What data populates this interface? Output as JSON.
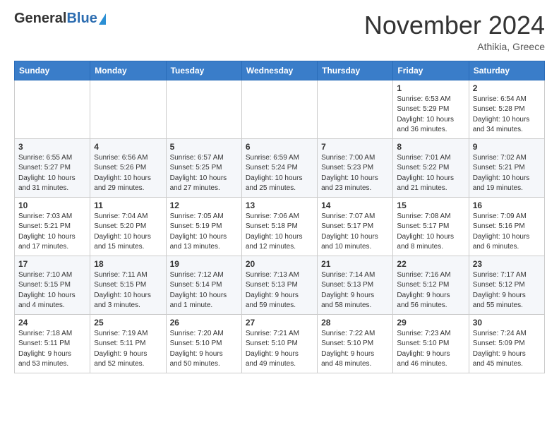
{
  "header": {
    "logo_general": "General",
    "logo_blue": "Blue",
    "month_title": "November 2024",
    "location": "Athikia, Greece"
  },
  "weekdays": [
    "Sunday",
    "Monday",
    "Tuesday",
    "Wednesday",
    "Thursday",
    "Friday",
    "Saturday"
  ],
  "weeks": [
    [
      {
        "day": "",
        "info": ""
      },
      {
        "day": "",
        "info": ""
      },
      {
        "day": "",
        "info": ""
      },
      {
        "day": "",
        "info": ""
      },
      {
        "day": "",
        "info": ""
      },
      {
        "day": "1",
        "info": "Sunrise: 6:53 AM\nSunset: 5:29 PM\nDaylight: 10 hours\nand 36 minutes."
      },
      {
        "day": "2",
        "info": "Sunrise: 6:54 AM\nSunset: 5:28 PM\nDaylight: 10 hours\nand 34 minutes."
      }
    ],
    [
      {
        "day": "3",
        "info": "Sunrise: 6:55 AM\nSunset: 5:27 PM\nDaylight: 10 hours\nand 31 minutes."
      },
      {
        "day": "4",
        "info": "Sunrise: 6:56 AM\nSunset: 5:26 PM\nDaylight: 10 hours\nand 29 minutes."
      },
      {
        "day": "5",
        "info": "Sunrise: 6:57 AM\nSunset: 5:25 PM\nDaylight: 10 hours\nand 27 minutes."
      },
      {
        "day": "6",
        "info": "Sunrise: 6:59 AM\nSunset: 5:24 PM\nDaylight: 10 hours\nand 25 minutes."
      },
      {
        "day": "7",
        "info": "Sunrise: 7:00 AM\nSunset: 5:23 PM\nDaylight: 10 hours\nand 23 minutes."
      },
      {
        "day": "8",
        "info": "Sunrise: 7:01 AM\nSunset: 5:22 PM\nDaylight: 10 hours\nand 21 minutes."
      },
      {
        "day": "9",
        "info": "Sunrise: 7:02 AM\nSunset: 5:21 PM\nDaylight: 10 hours\nand 19 minutes."
      }
    ],
    [
      {
        "day": "10",
        "info": "Sunrise: 7:03 AM\nSunset: 5:21 PM\nDaylight: 10 hours\nand 17 minutes."
      },
      {
        "day": "11",
        "info": "Sunrise: 7:04 AM\nSunset: 5:20 PM\nDaylight: 10 hours\nand 15 minutes."
      },
      {
        "day": "12",
        "info": "Sunrise: 7:05 AM\nSunset: 5:19 PM\nDaylight: 10 hours\nand 13 minutes."
      },
      {
        "day": "13",
        "info": "Sunrise: 7:06 AM\nSunset: 5:18 PM\nDaylight: 10 hours\nand 12 minutes."
      },
      {
        "day": "14",
        "info": "Sunrise: 7:07 AM\nSunset: 5:17 PM\nDaylight: 10 hours\nand 10 minutes."
      },
      {
        "day": "15",
        "info": "Sunrise: 7:08 AM\nSunset: 5:17 PM\nDaylight: 10 hours\nand 8 minutes."
      },
      {
        "day": "16",
        "info": "Sunrise: 7:09 AM\nSunset: 5:16 PM\nDaylight: 10 hours\nand 6 minutes."
      }
    ],
    [
      {
        "day": "17",
        "info": "Sunrise: 7:10 AM\nSunset: 5:15 PM\nDaylight: 10 hours\nand 4 minutes."
      },
      {
        "day": "18",
        "info": "Sunrise: 7:11 AM\nSunset: 5:15 PM\nDaylight: 10 hours\nand 3 minutes."
      },
      {
        "day": "19",
        "info": "Sunrise: 7:12 AM\nSunset: 5:14 PM\nDaylight: 10 hours\nand 1 minute."
      },
      {
        "day": "20",
        "info": "Sunrise: 7:13 AM\nSunset: 5:13 PM\nDaylight: 9 hours\nand 59 minutes."
      },
      {
        "day": "21",
        "info": "Sunrise: 7:14 AM\nSunset: 5:13 PM\nDaylight: 9 hours\nand 58 minutes."
      },
      {
        "day": "22",
        "info": "Sunrise: 7:16 AM\nSunset: 5:12 PM\nDaylight: 9 hours\nand 56 minutes."
      },
      {
        "day": "23",
        "info": "Sunrise: 7:17 AM\nSunset: 5:12 PM\nDaylight: 9 hours\nand 55 minutes."
      }
    ],
    [
      {
        "day": "24",
        "info": "Sunrise: 7:18 AM\nSunset: 5:11 PM\nDaylight: 9 hours\nand 53 minutes."
      },
      {
        "day": "25",
        "info": "Sunrise: 7:19 AM\nSunset: 5:11 PM\nDaylight: 9 hours\nand 52 minutes."
      },
      {
        "day": "26",
        "info": "Sunrise: 7:20 AM\nSunset: 5:10 PM\nDaylight: 9 hours\nand 50 minutes."
      },
      {
        "day": "27",
        "info": "Sunrise: 7:21 AM\nSunset: 5:10 PM\nDaylight: 9 hours\nand 49 minutes."
      },
      {
        "day": "28",
        "info": "Sunrise: 7:22 AM\nSunset: 5:10 PM\nDaylight: 9 hours\nand 48 minutes."
      },
      {
        "day": "29",
        "info": "Sunrise: 7:23 AM\nSunset: 5:10 PM\nDaylight: 9 hours\nand 46 minutes."
      },
      {
        "day": "30",
        "info": "Sunrise: 7:24 AM\nSunset: 5:09 PM\nDaylight: 9 hours\nand 45 minutes."
      }
    ]
  ]
}
